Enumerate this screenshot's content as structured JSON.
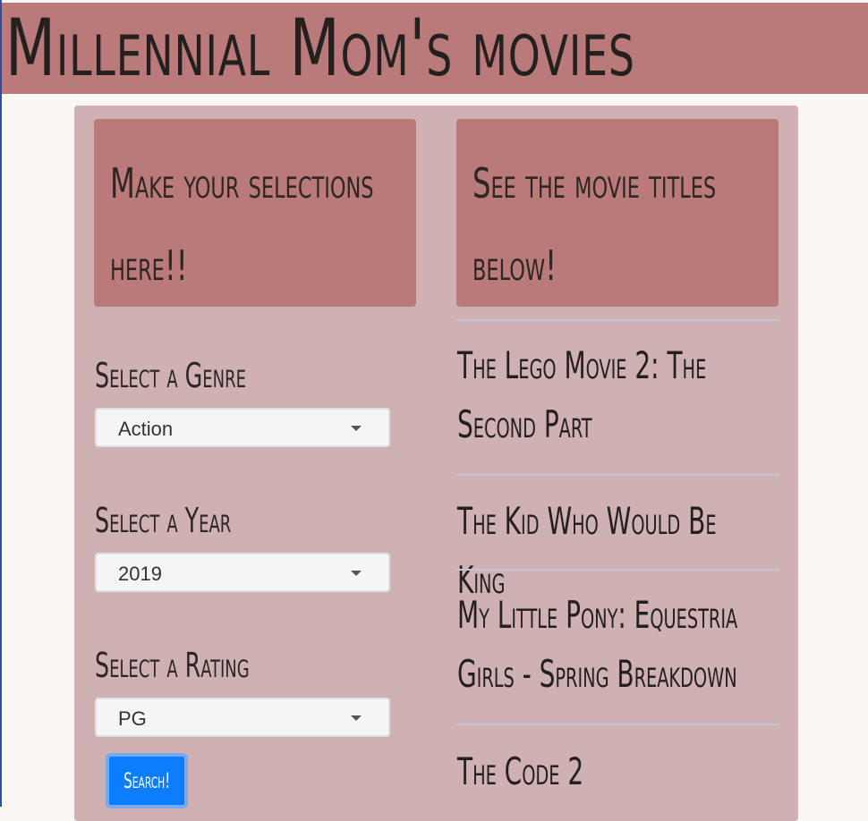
{
  "header": {
    "title": "Millennial Mom's movies"
  },
  "left_box": {
    "heading": "Make your selections here!!"
  },
  "right_box": {
    "heading": "See the movie titles below!"
  },
  "filters": {
    "genre": {
      "label": "Select a Genre",
      "value": "Action"
    },
    "year": {
      "label": "Select a Year",
      "value": "2019"
    },
    "rating": {
      "label": "Select a Rating",
      "value": "PG"
    },
    "search_label": "Search!"
  },
  "movies": [
    "The Lego Movie 2: The Second Part",
    "The Kid Who Would Be King",
    "My Little Pony: Equestria Girls - Spring Breakdown",
    "The Code 2"
  ]
}
